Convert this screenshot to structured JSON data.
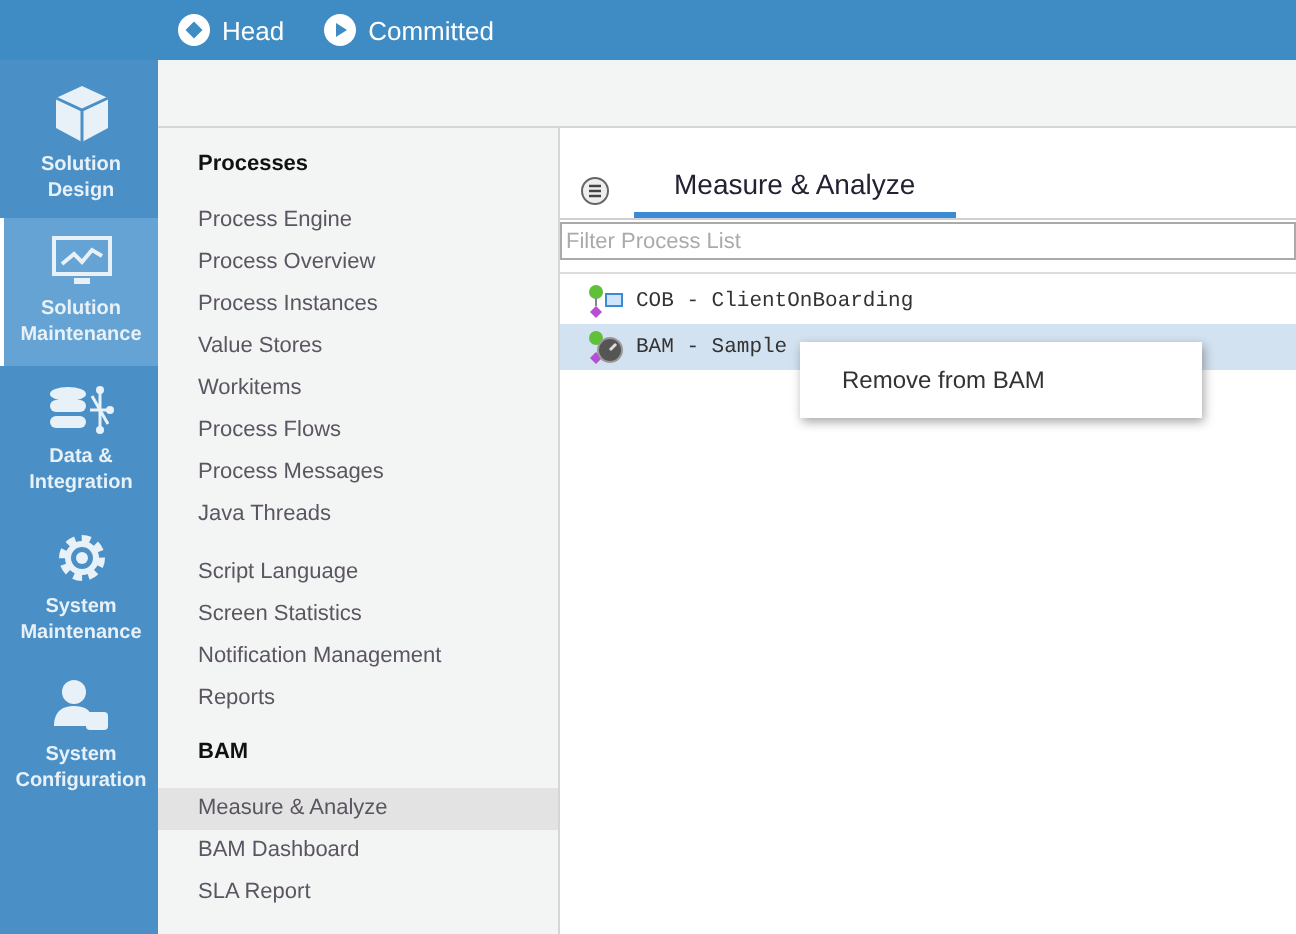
{
  "top_bar": {
    "items": [
      {
        "kind": "head",
        "label": "Head"
      },
      {
        "kind": "committed",
        "label": "Committed"
      }
    ]
  },
  "rail": {
    "items": [
      {
        "kind": "box",
        "label": "Solution Design",
        "selected": false
      },
      {
        "kind": "monitor",
        "label": "Solution Maintenance",
        "selected": true
      },
      {
        "kind": "database",
        "label": "Data & Integration",
        "selected": false
      },
      {
        "kind": "gear",
        "label": "System Maintenance",
        "selected": false
      },
      {
        "kind": "user",
        "label": "System Configuration",
        "selected": false
      }
    ]
  },
  "menu": {
    "groups": [
      {
        "header": "Processes",
        "items": [
          {
            "label": "Process Engine",
            "selected": false
          },
          {
            "label": "Process Overview",
            "selected": false
          },
          {
            "label": "Process Instances",
            "selected": false
          },
          {
            "label": "Value Stores",
            "selected": false
          },
          {
            "label": "Workitems",
            "selected": false
          },
          {
            "label": "Process Flows",
            "selected": false
          },
          {
            "label": "Process Messages",
            "selected": false
          },
          {
            "label": "Java Threads",
            "selected": false
          }
        ]
      },
      {
        "items": [
          {
            "label": "Script Language",
            "selected": false
          },
          {
            "label": "Screen Statistics",
            "selected": false
          },
          {
            "label": "Notification Management",
            "selected": false
          },
          {
            "label": "Reports",
            "selected": false
          }
        ]
      },
      {
        "header": "BAM",
        "items": [
          {
            "label": "Measure & Analyze",
            "selected": true
          },
          {
            "label": "BAM Dashboard",
            "selected": false
          },
          {
            "label": "SLA Report",
            "selected": false
          }
        ]
      }
    ]
  },
  "panel": {
    "tabs": [
      {
        "label": "Measure & Analyze",
        "selected": true
      }
    ],
    "filter": {
      "placeholder": "Filter Process List"
    },
    "processes": [
      {
        "kind": "flow",
        "name": "COB - ClientOnBoarding",
        "selected": false
      },
      {
        "kind": "gauge",
        "name": "BAM - Sample",
        "selected": true
      }
    ],
    "context_menu": {
      "items": [
        "Remove from BAM"
      ]
    }
  }
}
